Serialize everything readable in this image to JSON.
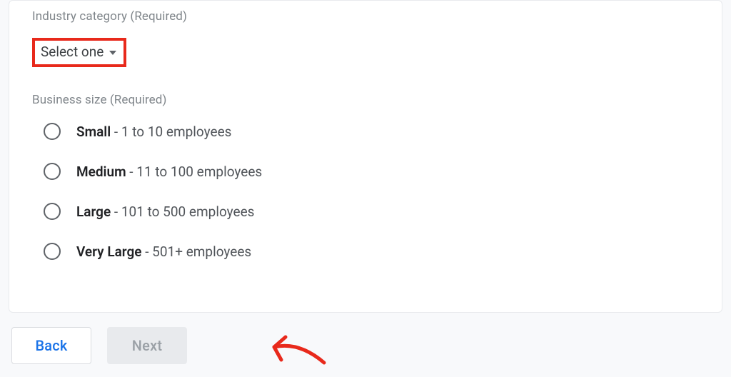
{
  "industry": {
    "label": "Industry category (Required)",
    "select_placeholder": "Select one"
  },
  "business_size": {
    "label": "Business size (Required)",
    "options": [
      {
        "name": "Small",
        "desc": " - 1 to 10 employees"
      },
      {
        "name": "Medium",
        "desc": " - 11 to 100 employees"
      },
      {
        "name": "Large",
        "desc": " - 101 to 500 employees"
      },
      {
        "name": "Very Large",
        "desc": " - 501+ employees"
      }
    ]
  },
  "buttons": {
    "back": "Back",
    "next": "Next"
  },
  "annotations": {
    "highlight_color": "#e8291b"
  }
}
